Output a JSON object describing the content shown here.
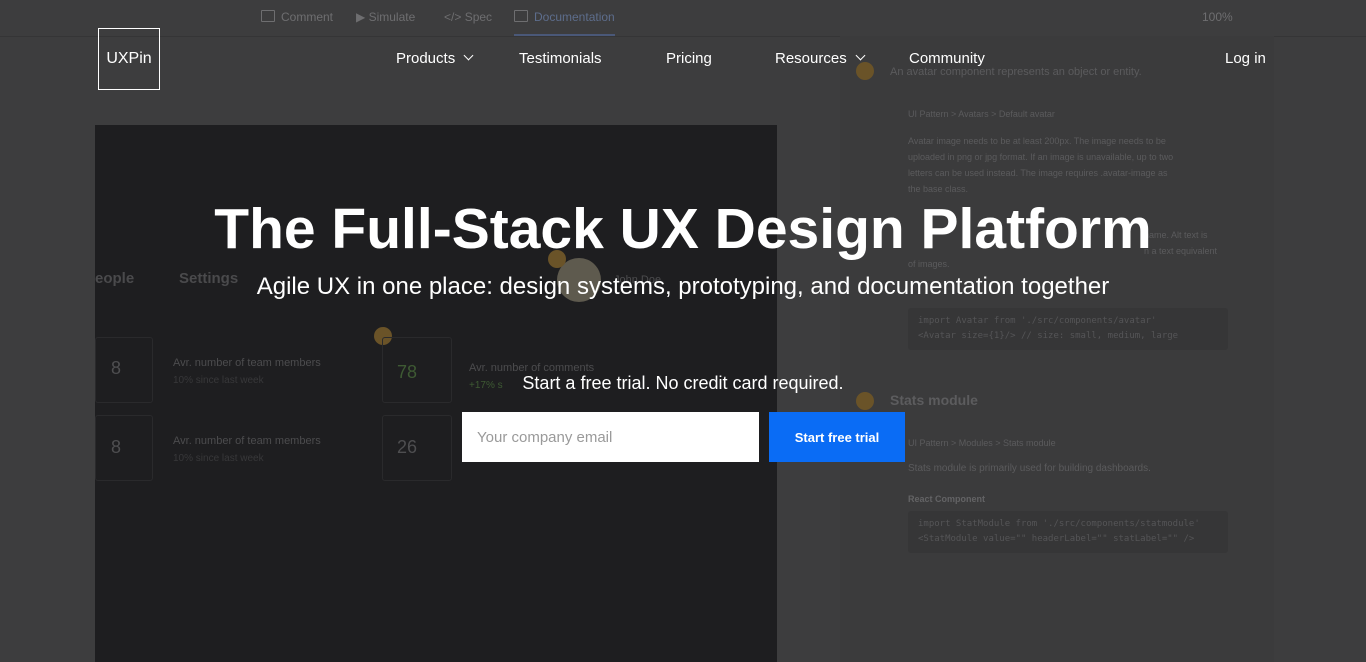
{
  "background": {
    "toolbar": {
      "items": [
        "Comment",
        "Simulate",
        "Spec",
        "Documentation"
      ],
      "zoom": "100%"
    },
    "canvas": {
      "tabs": [
        "eople",
        "Settings"
      ],
      "user_name": "John Doe",
      "badge_1": "1",
      "badge_2": "2",
      "cards": [
        {
          "value": "8",
          "label": "Avr. number of team members",
          "sub": "10% since last week"
        },
        {
          "value": "78",
          "label": "Avr. number of comments",
          "sub": "+17% s"
        },
        {
          "value": "8",
          "label": "Avr. number of team members",
          "sub": "10% since last week"
        },
        {
          "value": "26",
          "label": "",
          "sub": ""
        }
      ]
    },
    "docs": {
      "intro": "An avatar component represents an object or entity.",
      "breadcrumb_1": "UI Pattern  >  Avatars  >  Default avatar",
      "para_1": "Avatar image needs to be at least 200px. The image needs to be\nuploaded in png or jpg format. If an image is unavailable, up to two\nletters can be used instead. The image requires .avatar-image as\nthe base class.",
      "para_2": "name. Alt text is\nn a text equivalent",
      "para_2b": "of images.",
      "code_1": "import Avatar from './src/components/avatar'\n<Avatar size={1}/> // size: small, medium, large",
      "section_title": "Stats module",
      "breadcrumb_2": "UI Pattern  >  Modules  >  Stats module",
      "para_3": "Stats module is primarily used for building dashboards.",
      "sub_title": "React Component",
      "code_2": "import StatModule from './src/components/statmodule'\n<StatModule value=\"\" headerLabel=\"\" statLabel=\"\" />"
    }
  },
  "nav": {
    "logo": "UXPin",
    "items": [
      {
        "label": "Products",
        "dropdown": true
      },
      {
        "label": "Testimonials",
        "dropdown": false
      },
      {
        "label": "Pricing",
        "dropdown": false
      },
      {
        "label": "Resources",
        "dropdown": true
      },
      {
        "label": "Community",
        "dropdown": false
      }
    ],
    "login": "Log in"
  },
  "hero": {
    "title": "The Full-Stack UX Design Platform",
    "subtitle": "Agile UX in one place: design systems, prototyping, and documentation together",
    "trial_text": "Start a free trial. No credit card required.",
    "email_placeholder": "Your company email",
    "cta": "Start free trial"
  },
  "colors": {
    "overlay_bg": "#3d3d3e",
    "cta": "#0a6cf5"
  }
}
